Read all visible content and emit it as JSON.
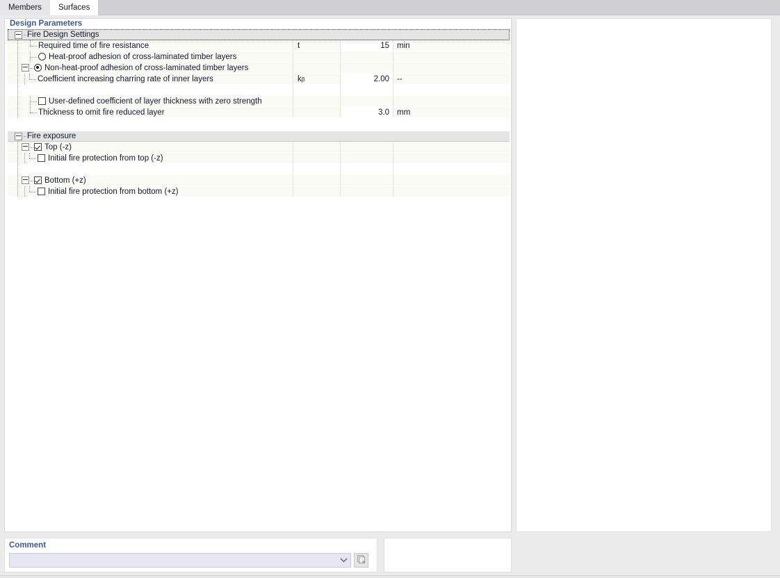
{
  "tabs": [
    {
      "label": "Members",
      "active": false
    },
    {
      "label": "Surfaces",
      "active": true
    }
  ],
  "left_panel": {
    "title": "Design Parameters",
    "groups": [
      {
        "name": "Fire Design Settings",
        "focused": true,
        "rows": [
          {
            "label": "Required time of fire resistance",
            "symbol": "t",
            "value": "15",
            "unit": "min",
            "control": "none"
          },
          {
            "label": "Heat-proof adhesion of cross-laminated timber layers",
            "symbol": "",
            "value": "",
            "unit": "",
            "control": "radio",
            "checked": false
          },
          {
            "label": "Non-heat-proof adhesion of cross-laminated timber layers",
            "symbol": "",
            "value": "",
            "unit": "",
            "control": "radio",
            "checked": true
          },
          {
            "label": "Coefficient increasing charring rate of inner layers",
            "symbol": "kβ",
            "symbol_base": "k",
            "symbol_sub": "β",
            "value": "2.00",
            "unit": "--",
            "control": "none"
          },
          {
            "label": "User-defined coefficient of layer thickness with zero strength",
            "symbol": "",
            "value": "",
            "unit": "",
            "control": "checkbox",
            "checked": false
          },
          {
            "label": "Thickness to omit fire reduced layer",
            "symbol": "",
            "value": "3.0",
            "unit": "mm",
            "control": "none"
          }
        ]
      },
      {
        "name": "Fire exposure",
        "focused": false,
        "rows": [
          {
            "label": "Top (-z)",
            "symbol": "",
            "value": "",
            "unit": "",
            "control": "checkbox",
            "checked": true
          },
          {
            "label": "Initial fire protection from top (-z)",
            "symbol": "",
            "value": "",
            "unit": "",
            "control": "checkbox",
            "checked": false
          },
          {
            "label": "Bottom (+z)",
            "symbol": "",
            "value": "",
            "unit": "",
            "control": "checkbox",
            "checked": true
          },
          {
            "label": "Initial fire protection from bottom (+z)",
            "symbol": "",
            "value": "",
            "unit": "",
            "control": "checkbox",
            "checked": false
          }
        ]
      }
    ]
  },
  "comment": {
    "title": "Comment",
    "value": "",
    "placeholder": ""
  },
  "colors": {
    "accent_title": "#3f5a8f",
    "group_header_bg": "#e4e4e4",
    "row_bg": "#fafaf5",
    "tab_active_bg": "#ffffff",
    "tab_inactive_bg": "#e6e6e8",
    "combo_bg": "#e6e6f2",
    "window_bg": "#ebebeb"
  }
}
